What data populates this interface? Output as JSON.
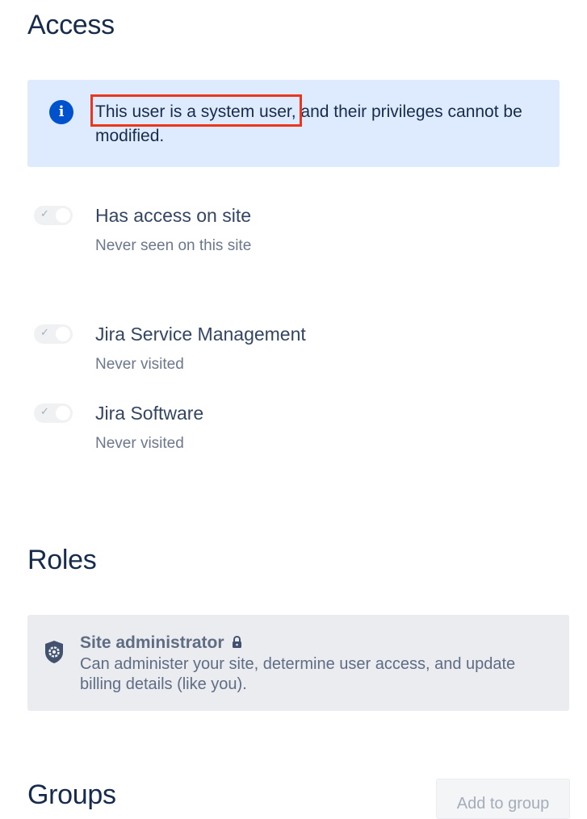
{
  "access": {
    "heading": "Access",
    "banner": {
      "icon": "info-icon",
      "text": "This user is a system user, and their privileges cannot be modified.",
      "highlighted_phrase": "This user is a system user,"
    },
    "items": [
      {
        "title": "Has access on site",
        "subtitle": "Never seen on this site",
        "enabled": true
      },
      {
        "title": "Jira Service Management",
        "subtitle": "Never visited",
        "enabled": true
      },
      {
        "title": "Jira Software",
        "subtitle": "Never visited",
        "enabled": true
      }
    ]
  },
  "roles": {
    "heading": "Roles",
    "card": {
      "icon": "shield-gear-icon",
      "title": "Site administrator",
      "locked": true,
      "description": "Can administer your site, determine user access, and update billing details (like you)."
    }
  },
  "groups": {
    "heading": "Groups",
    "add_button_label": "Add to group"
  },
  "colors": {
    "banner_bg": "#deebff",
    "info_icon": "#0052cc",
    "highlight_border": "#e8361f",
    "role_card_bg": "#ebecf0"
  }
}
